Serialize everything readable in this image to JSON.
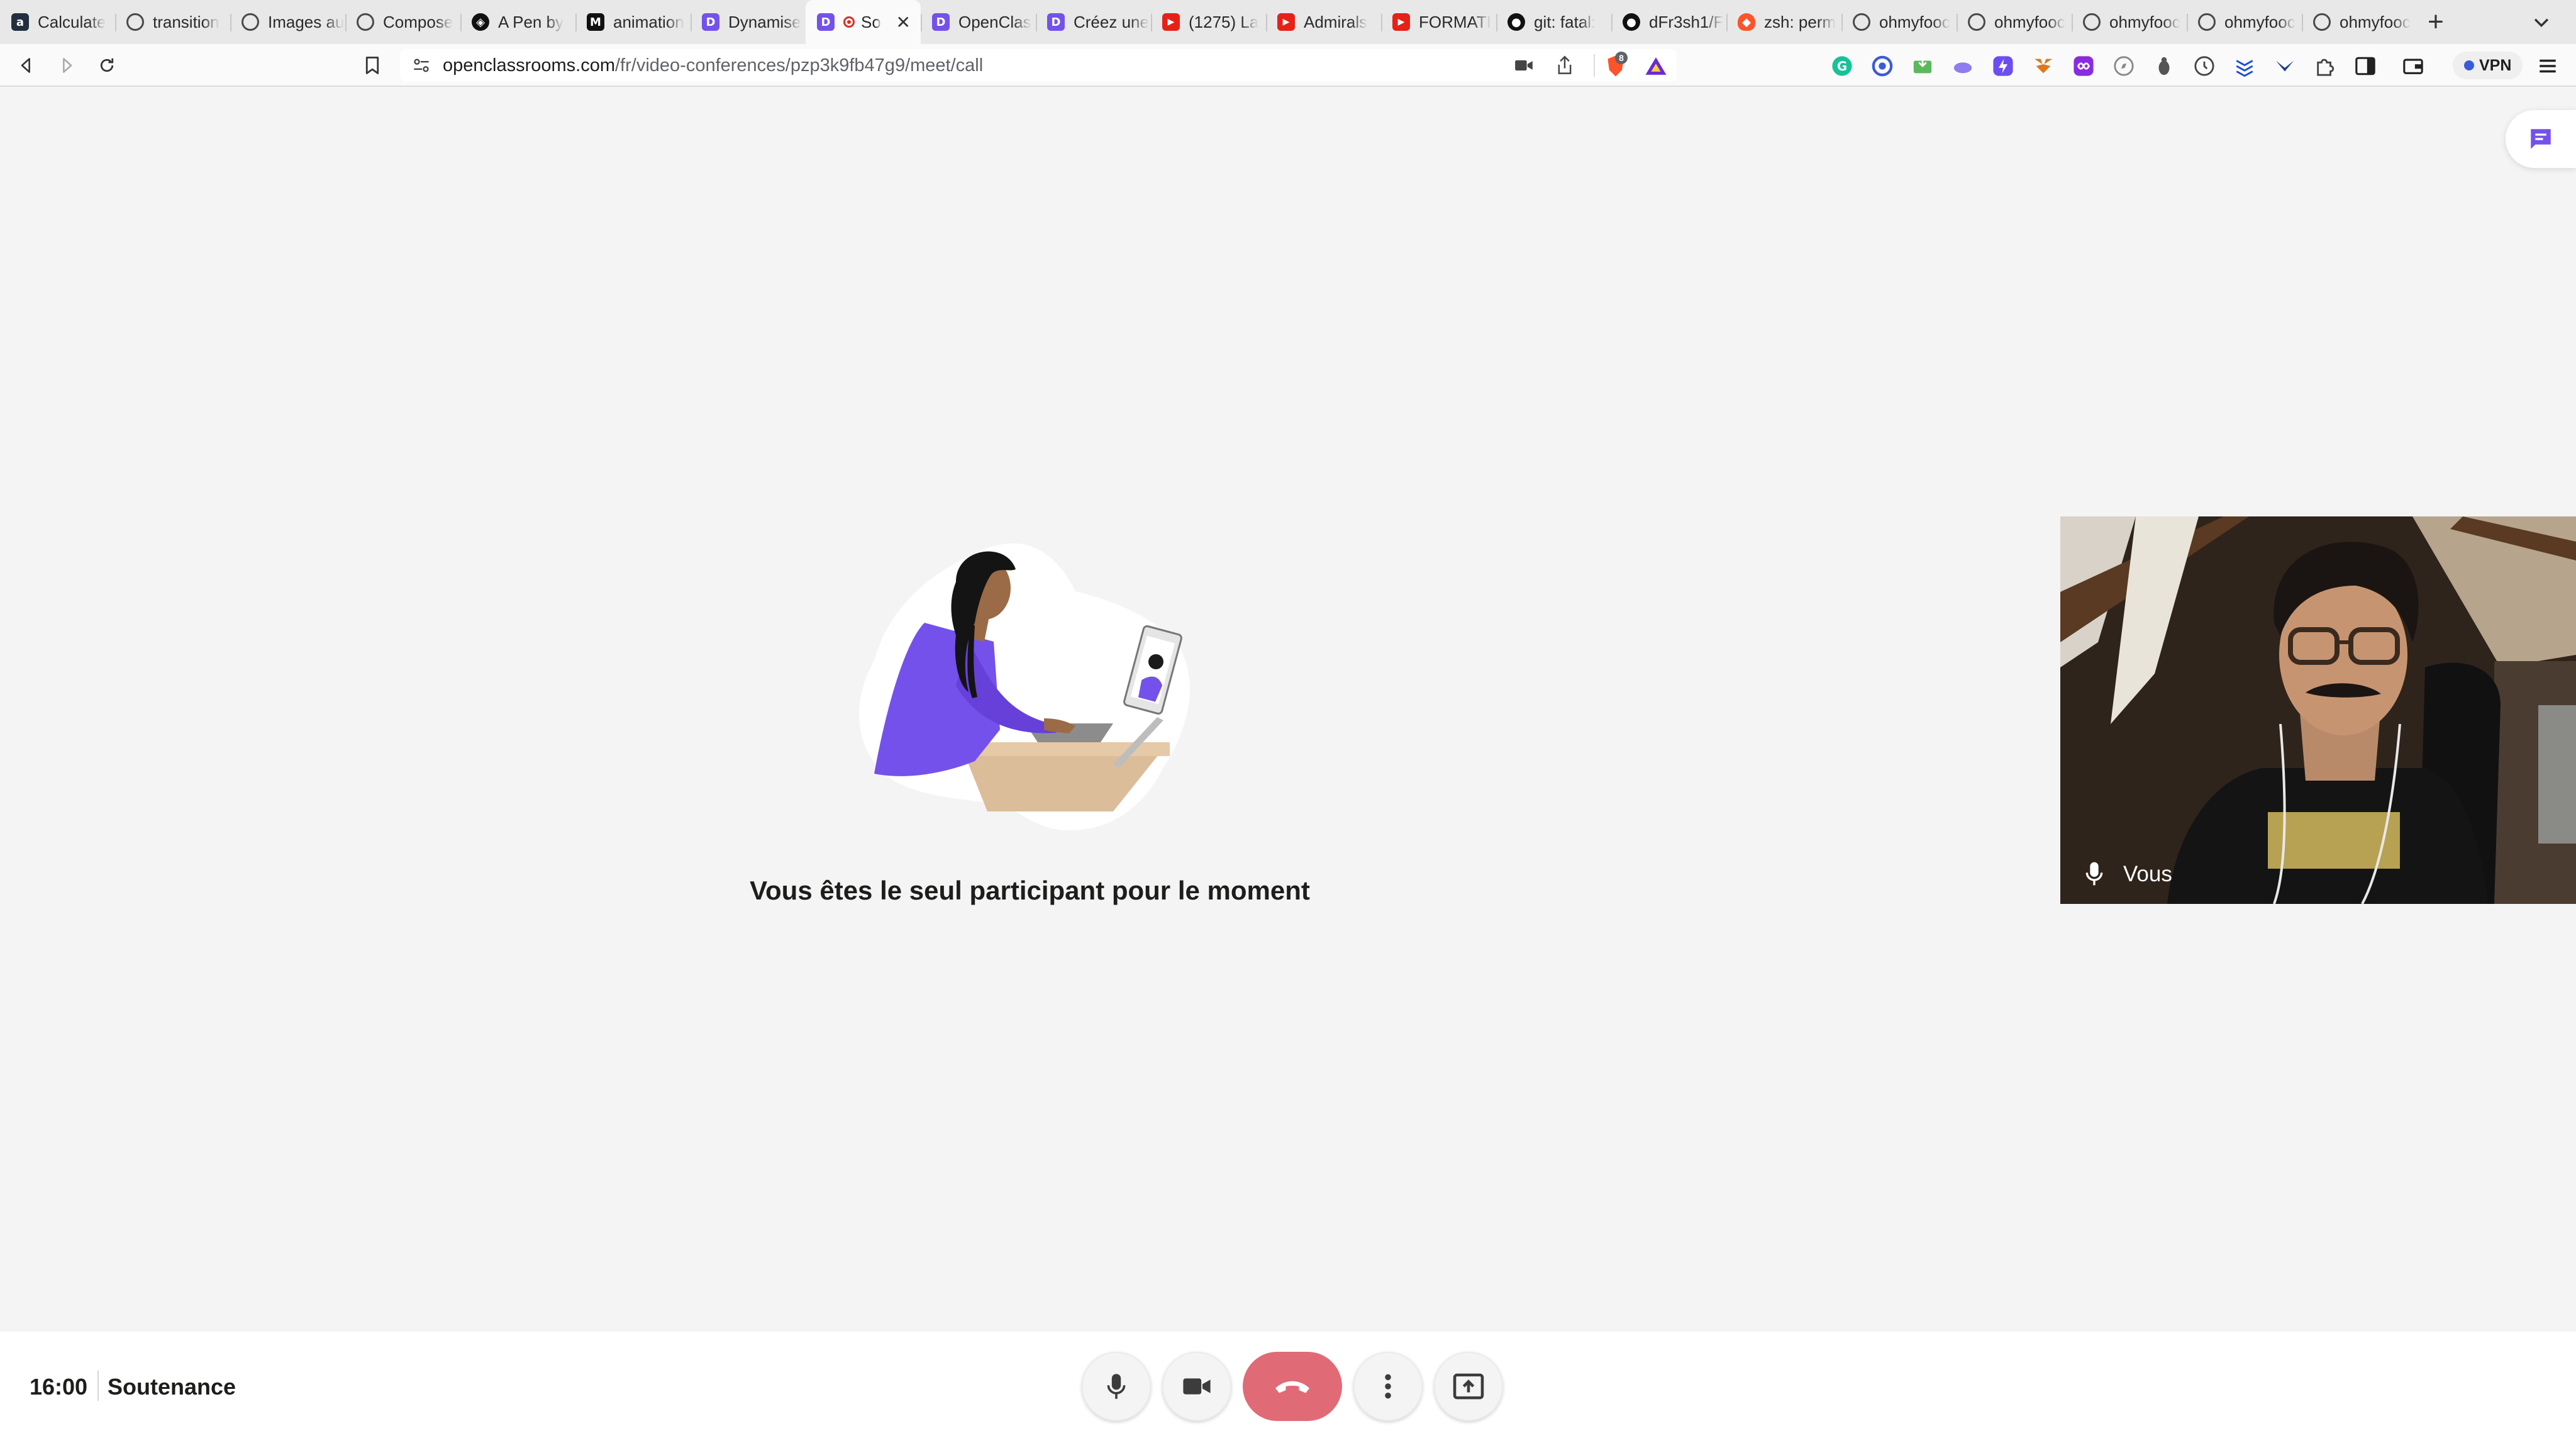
{
  "browser": {
    "tabs": [
      {
        "favicon": "amazon-icon",
        "title": "Calculate"
      },
      {
        "favicon": "globe-icon",
        "title": "transition"
      },
      {
        "favicon": "globe-icon",
        "title": "Images au"
      },
      {
        "favicon": "globe-icon",
        "title": "Compose"
      },
      {
        "favicon": "codepen-icon",
        "title": "A Pen by"
      },
      {
        "favicon": "medium-icon",
        "title": "animation"
      },
      {
        "favicon": "openclassrooms-icon",
        "title": "Dynamise"
      },
      {
        "favicon": "openclassrooms-icon",
        "title": "So",
        "active": true,
        "recording": true
      },
      {
        "favicon": "openclassrooms-icon",
        "title": "OpenClas"
      },
      {
        "favicon": "openclassrooms-icon",
        "title": "Créez une"
      },
      {
        "favicon": "youtube-icon",
        "title": "(1275) La"
      },
      {
        "favicon": "youtube-icon",
        "title": "Admirals"
      },
      {
        "favicon": "youtube-icon",
        "title": "FORMATI"
      },
      {
        "favicon": "github-icon",
        "title": "git: fatal:"
      },
      {
        "favicon": "github-icon",
        "title": "dFr3sh1/F"
      },
      {
        "favicon": "brave-icon",
        "title": "zsh: perm"
      },
      {
        "favicon": "globe-icon",
        "title": "ohmyfooc"
      },
      {
        "favicon": "globe-icon",
        "title": "ohmyfooc"
      },
      {
        "favicon": "globe-icon",
        "title": "ohmyfooc"
      },
      {
        "favicon": "globe-icon",
        "title": "ohmyfooc"
      },
      {
        "favicon": "globe-icon",
        "title": "ohmyfooc"
      }
    ],
    "url": {
      "domain": "openclassrooms.com",
      "path": "/fr/video-conferences/pzp3k9fb47g9/meet/call"
    },
    "brave_badge": "8",
    "vpn_label": "VPN"
  },
  "meeting": {
    "solo_message": "Vous êtes le seul participant pour le moment",
    "self_name": "Vous",
    "time": "16:00",
    "title": "Soutenance"
  },
  "colors": {
    "accent": "#7451eb",
    "hangup": "#e06b76",
    "background": "#f4f4f4"
  }
}
